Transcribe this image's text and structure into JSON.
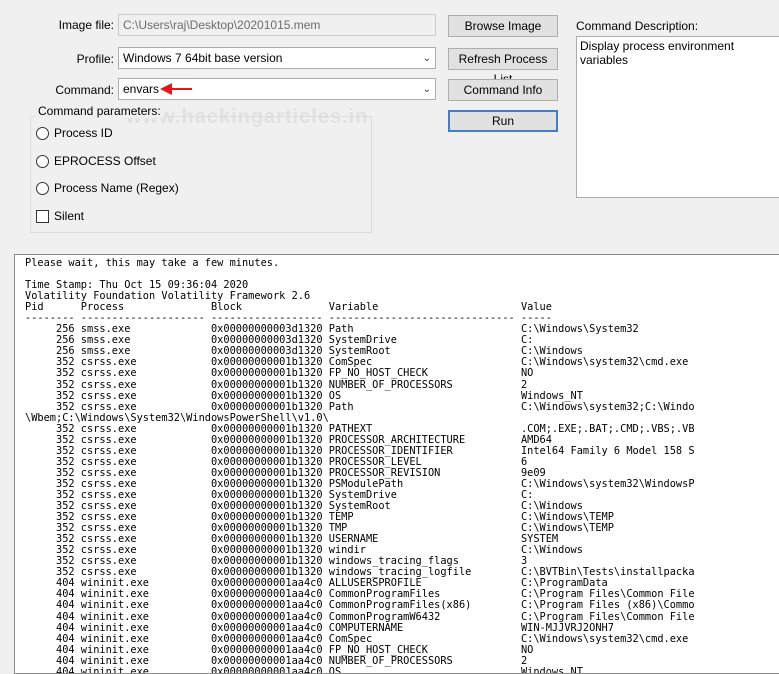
{
  "form": {
    "image_file_label": "Image file:",
    "image_file_value": "C:\\Users\\raj\\Desktop\\20201015.mem",
    "profile_label": "Profile:",
    "profile_value": "Windows 7 64bit base version",
    "command_label": "Command:",
    "command_value": "envars",
    "params_label": "Command parameters:",
    "pid_label": "Process ID",
    "eprocess_label": "EPROCESS Offset",
    "procname_label": "Process Name (Regex)",
    "silent_label": "Silent"
  },
  "buttons": {
    "browse": "Browse Image",
    "refresh": "Refresh Process List",
    "command_info": "Command Info",
    "run": "Run"
  },
  "description": {
    "label": "Command Description:",
    "text": "Display process environment variables"
  },
  "watermark": "www.hackingarticles.in",
  "output": {
    "text": "Please wait, this may take a few minutes.\n\nTime Stamp: Thu Oct 15 09:36:04 2020\nVolatility Foundation Volatility Framework 2.6\nPid      Process              Block              Variable                       Value\n-------- -------------------- ------------------ ------------------------------ -----\n     256 smss.exe             0x00000000003d1320 Path                           C:\\Windows\\System32\n     256 smss.exe             0x00000000003d1320 SystemDrive                    C:\n     256 smss.exe             0x00000000003d1320 SystemRoot                     C:\\Windows\n     352 csrss.exe            0x00000000001b1320 ComSpec                        C:\\Windows\\system32\\cmd.exe\n     352 csrss.exe            0x00000000001b1320 FP_NO_HOST_CHECK               NO\n     352 csrss.exe            0x00000000001b1320 NUMBER_OF_PROCESSORS           2\n     352 csrss.exe            0x00000000001b1320 OS                             Windows_NT\n     352 csrss.exe            0x00000000001b1320 Path                           C:\\Windows\\system32;C:\\Windo\n\\Wbem;C:\\Windows\\System32\\WindowsPowerShell\\v1.0\\\n     352 csrss.exe            0x00000000001b1320 PATHEXT                        .COM;.EXE;.BAT;.CMD;.VBS;.VB\n     352 csrss.exe            0x00000000001b1320 PROCESSOR_ARCHITECTURE         AMD64\n     352 csrss.exe            0x00000000001b1320 PROCESSOR_IDENTIFIER           Intel64 Family 6 Model 158 S\n     352 csrss.exe            0x00000000001b1320 PROCESSOR_LEVEL                6\n     352 csrss.exe            0x00000000001b1320 PROCESSOR_REVISION             9e09\n     352 csrss.exe            0x00000000001b1320 PSModulePath                   C:\\Windows\\system32\\WindowsP\n     352 csrss.exe            0x00000000001b1320 SystemDrive                    C:\n     352 csrss.exe            0x00000000001b1320 SystemRoot                     C:\\Windows\n     352 csrss.exe            0x00000000001b1320 TEMP                           C:\\Windows\\TEMP\n     352 csrss.exe            0x00000000001b1320 TMP                            C:\\Windows\\TEMP\n     352 csrss.exe            0x00000000001b1320 USERNAME                       SYSTEM\n     352 csrss.exe            0x00000000001b1320 windir                         C:\\Windows\n     352 csrss.exe            0x00000000001b1320 windows_tracing_flags          3\n     352 csrss.exe            0x00000000001b1320 windows_tracing_logfile        C:\\BVTBin\\Tests\\installpacka\n     404 wininit.exe          0x00000000001aa4c0 ALLUSERSPROFILE                C:\\ProgramData\n     404 wininit.exe          0x00000000001aa4c0 CommonProgramFiles             C:\\Program Files\\Common File\n     404 wininit.exe          0x00000000001aa4c0 CommonProgramFiles(x86)        C:\\Program Files (x86)\\Commo\n     404 wininit.exe          0x00000000001aa4c0 CommonProgramW6432             C:\\Program Files\\Common File\n     404 wininit.exe          0x00000000001aa4c0 COMPUTERNAME                   WIN-MJJVRJ2ONH7\n     404 wininit.exe          0x00000000001aa4c0 ComSpec                        C:\\Windows\\system32\\cmd.exe\n     404 wininit.exe          0x00000000001aa4c0 FP_NO_HOST_CHECK               NO\n     404 wininit.exe          0x00000000001aa4c0 NUMBER_OF_PROCESSORS           2\n     404 wininit.exe          0x00000000001aa4c0 OS                             Windows_NT"
  },
  "icons": {
    "annotation_arrow": "red-arrow-icon",
    "dropdown": "chevron-down-icon"
  },
  "colors": {
    "arrow": "#e8141b",
    "default_button_border": "#3c7fd3"
  }
}
